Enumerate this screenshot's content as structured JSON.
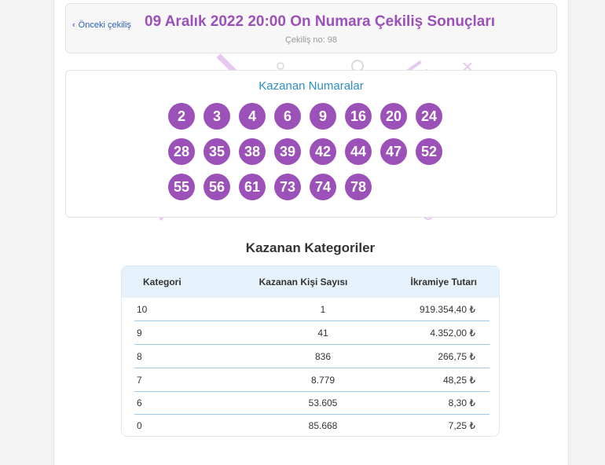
{
  "header": {
    "back_label": "Önceki çekiliş",
    "title": "09 Aralık 2022 20:00 On Numara Çekiliş Sonuçları",
    "draw_number": "Çekiliş no: 98"
  },
  "numbers": {
    "title": "Kazanan Numaralar",
    "balls": [
      "2",
      "3",
      "4",
      "6",
      "9",
      "16",
      "20",
      "24",
      "28",
      "35",
      "38",
      "39",
      "42",
      "44",
      "47",
      "52",
      "55",
      "56",
      "61",
      "73",
      "74",
      "78"
    ]
  },
  "categories": {
    "title": "Kazanan Kategoriler",
    "columns": [
      "Kategori",
      "Kazanan Kişi Sayısı",
      "İkramiye Tutarı"
    ],
    "rows": [
      {
        "category": "10",
        "winners": "1",
        "prize": "919.354,40 ₺"
      },
      {
        "category": "9",
        "winners": "41",
        "prize": "4.352,00 ₺"
      },
      {
        "category": "8",
        "winners": "836",
        "prize": "266,75 ₺"
      },
      {
        "category": "7",
        "winners": "8.779",
        "prize": "48,25 ₺"
      },
      {
        "category": "6",
        "winners": "53.605",
        "prize": "8,30 ₺"
      },
      {
        "category": "0",
        "winners": "85.668",
        "prize": "7,25 ₺"
      }
    ]
  },
  "colors": {
    "ball": "#9b51b7",
    "title": "#9b51b7",
    "accent": "#2e8fc8",
    "table_head": "#e6f2fb"
  }
}
